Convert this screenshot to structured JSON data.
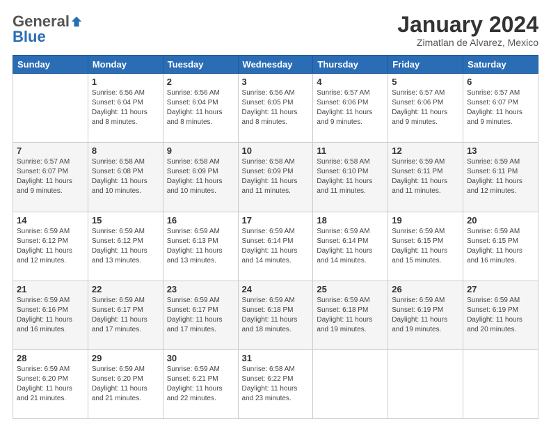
{
  "logo": {
    "general": "General",
    "blue": "Blue"
  },
  "title": "January 2024",
  "subtitle": "Zimatlan de Alvarez, Mexico",
  "days_of_week": [
    "Sunday",
    "Monday",
    "Tuesday",
    "Wednesday",
    "Thursday",
    "Friday",
    "Saturday"
  ],
  "weeks": [
    [
      {
        "day": "",
        "info": ""
      },
      {
        "day": "1",
        "info": "Sunrise: 6:56 AM\nSunset: 6:04 PM\nDaylight: 11 hours\nand 8 minutes."
      },
      {
        "day": "2",
        "info": "Sunrise: 6:56 AM\nSunset: 6:04 PM\nDaylight: 11 hours\nand 8 minutes."
      },
      {
        "day": "3",
        "info": "Sunrise: 6:56 AM\nSunset: 6:05 PM\nDaylight: 11 hours\nand 8 minutes."
      },
      {
        "day": "4",
        "info": "Sunrise: 6:57 AM\nSunset: 6:06 PM\nDaylight: 11 hours\nand 9 minutes."
      },
      {
        "day": "5",
        "info": "Sunrise: 6:57 AM\nSunset: 6:06 PM\nDaylight: 11 hours\nand 9 minutes."
      },
      {
        "day": "6",
        "info": "Sunrise: 6:57 AM\nSunset: 6:07 PM\nDaylight: 11 hours\nand 9 minutes."
      }
    ],
    [
      {
        "day": "7",
        "info": "Sunrise: 6:57 AM\nSunset: 6:07 PM\nDaylight: 11 hours\nand 9 minutes."
      },
      {
        "day": "8",
        "info": "Sunrise: 6:58 AM\nSunset: 6:08 PM\nDaylight: 11 hours\nand 10 minutes."
      },
      {
        "day": "9",
        "info": "Sunrise: 6:58 AM\nSunset: 6:09 PM\nDaylight: 11 hours\nand 10 minutes."
      },
      {
        "day": "10",
        "info": "Sunrise: 6:58 AM\nSunset: 6:09 PM\nDaylight: 11 hours\nand 11 minutes."
      },
      {
        "day": "11",
        "info": "Sunrise: 6:58 AM\nSunset: 6:10 PM\nDaylight: 11 hours\nand 11 minutes."
      },
      {
        "day": "12",
        "info": "Sunrise: 6:59 AM\nSunset: 6:11 PM\nDaylight: 11 hours\nand 11 minutes."
      },
      {
        "day": "13",
        "info": "Sunrise: 6:59 AM\nSunset: 6:11 PM\nDaylight: 11 hours\nand 12 minutes."
      }
    ],
    [
      {
        "day": "14",
        "info": "Sunrise: 6:59 AM\nSunset: 6:12 PM\nDaylight: 11 hours\nand 12 minutes."
      },
      {
        "day": "15",
        "info": "Sunrise: 6:59 AM\nSunset: 6:12 PM\nDaylight: 11 hours\nand 13 minutes."
      },
      {
        "day": "16",
        "info": "Sunrise: 6:59 AM\nSunset: 6:13 PM\nDaylight: 11 hours\nand 13 minutes."
      },
      {
        "day": "17",
        "info": "Sunrise: 6:59 AM\nSunset: 6:14 PM\nDaylight: 11 hours\nand 14 minutes."
      },
      {
        "day": "18",
        "info": "Sunrise: 6:59 AM\nSunset: 6:14 PM\nDaylight: 11 hours\nand 14 minutes."
      },
      {
        "day": "19",
        "info": "Sunrise: 6:59 AM\nSunset: 6:15 PM\nDaylight: 11 hours\nand 15 minutes."
      },
      {
        "day": "20",
        "info": "Sunrise: 6:59 AM\nSunset: 6:15 PM\nDaylight: 11 hours\nand 16 minutes."
      }
    ],
    [
      {
        "day": "21",
        "info": "Sunrise: 6:59 AM\nSunset: 6:16 PM\nDaylight: 11 hours\nand 16 minutes."
      },
      {
        "day": "22",
        "info": "Sunrise: 6:59 AM\nSunset: 6:17 PM\nDaylight: 11 hours\nand 17 minutes."
      },
      {
        "day": "23",
        "info": "Sunrise: 6:59 AM\nSunset: 6:17 PM\nDaylight: 11 hours\nand 17 minutes."
      },
      {
        "day": "24",
        "info": "Sunrise: 6:59 AM\nSunset: 6:18 PM\nDaylight: 11 hours\nand 18 minutes."
      },
      {
        "day": "25",
        "info": "Sunrise: 6:59 AM\nSunset: 6:18 PM\nDaylight: 11 hours\nand 19 minutes."
      },
      {
        "day": "26",
        "info": "Sunrise: 6:59 AM\nSunset: 6:19 PM\nDaylight: 11 hours\nand 19 minutes."
      },
      {
        "day": "27",
        "info": "Sunrise: 6:59 AM\nSunset: 6:19 PM\nDaylight: 11 hours\nand 20 minutes."
      }
    ],
    [
      {
        "day": "28",
        "info": "Sunrise: 6:59 AM\nSunset: 6:20 PM\nDaylight: 11 hours\nand 21 minutes."
      },
      {
        "day": "29",
        "info": "Sunrise: 6:59 AM\nSunset: 6:20 PM\nDaylight: 11 hours\nand 21 minutes."
      },
      {
        "day": "30",
        "info": "Sunrise: 6:59 AM\nSunset: 6:21 PM\nDaylight: 11 hours\nand 22 minutes."
      },
      {
        "day": "31",
        "info": "Sunrise: 6:58 AM\nSunset: 6:22 PM\nDaylight: 11 hours\nand 23 minutes."
      },
      {
        "day": "",
        "info": ""
      },
      {
        "day": "",
        "info": ""
      },
      {
        "day": "",
        "info": ""
      }
    ]
  ]
}
